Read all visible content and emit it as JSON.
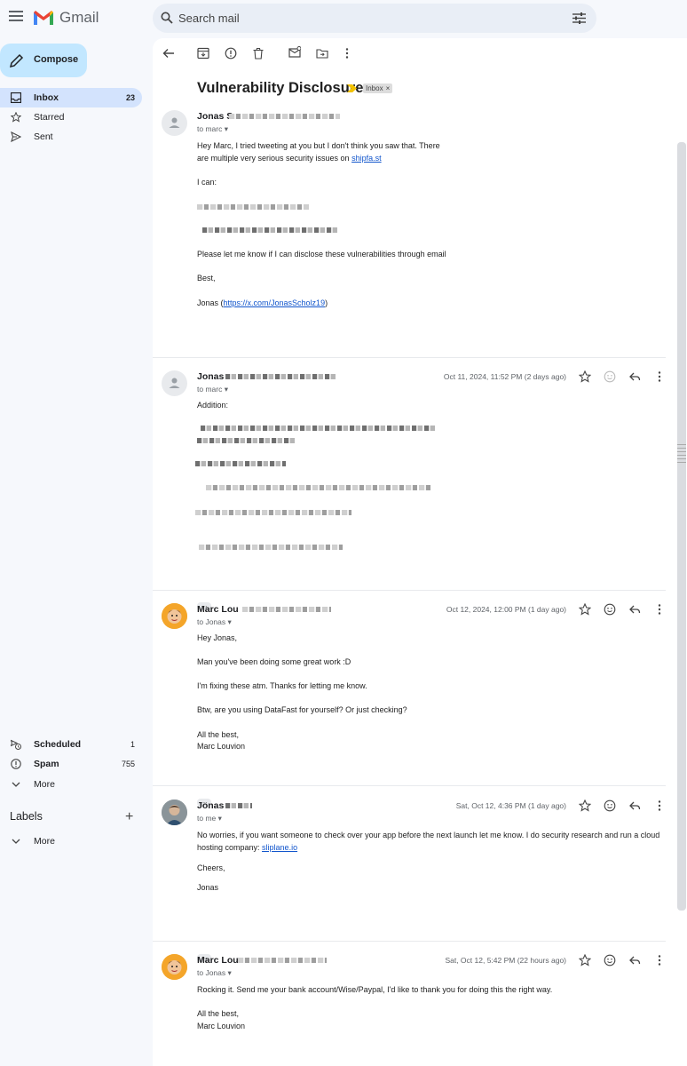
{
  "app": {
    "name": "Gmail"
  },
  "search": {
    "placeholder": "Search mail"
  },
  "sidebar": {
    "compose_label": "Compose",
    "items": [
      {
        "label": "Inbox",
        "count": "23",
        "icon": "inbox-icon",
        "active": true
      },
      {
        "label": "Starred",
        "count": "",
        "icon": "star-icon"
      },
      {
        "label": "Sent",
        "count": "",
        "icon": "send-icon"
      },
      {
        "label": "Scheduled",
        "count": "1",
        "icon": "scheduled-icon"
      },
      {
        "label": "Spam",
        "count": "755",
        "icon": "spam-icon"
      },
      {
        "label": "More",
        "count": "",
        "icon": "chevron-down-icon"
      }
    ],
    "labels_heading": "Labels",
    "labels_more": "More"
  },
  "thread": {
    "subject": "Vulnerability Disclosure",
    "chip": "Inbox",
    "chip_close": "×",
    "messages": [
      {
        "sender": "Jonas S",
        "to": "to marc",
        "date": "",
        "lines": [
          "Hey Marc, I tried tweeting at you but I don't think you saw that. There",
          "are multiple very serious security issues on ",
          "I can:",
          "Please let me know if I can disclose these vulnerabilities through email",
          "Best,",
          "Jonas (",
          ")"
        ],
        "link1": "shipfa.st",
        "link2": "https://x.com/JonasScholz19"
      },
      {
        "sender": "Jonas",
        "to": "to marc",
        "date": "Oct 11, 2024, 11:52 PM (2 days ago)",
        "lines": [
          "Addition:"
        ]
      },
      {
        "sender": "Marc Lou",
        "to": "to Jonas",
        "date": "Oct 12, 2024, 12:00 PM (1 day ago)",
        "lines": [
          "Hey Jonas,",
          "Man you've been doing some great work :D",
          "I'm fixing these atm. Thanks for letting me know.",
          "Btw, are you using DataFast for yourself? Or just checking?",
          "All the best,",
          "Marc Louvion"
        ]
      },
      {
        "sender": "Jonas",
        "to": "to me",
        "date": "Sat, Oct 12, 4:36 PM (1 day ago)",
        "lines": [
          "No worries, if you want someone to check over your app before the next launch let me know. I do security research and run a cloud",
          "hosting company: ",
          "Cheers,",
          "Jonas"
        ],
        "link1": "sliplane.io"
      },
      {
        "sender": "Marc Lou",
        "to": "to Jonas",
        "date": "Sat, Oct 12, 5:42 PM (22 hours ago)",
        "lines": [
          "Rocking it. Send me your bank account/Wise/Paypal, I'd like to thank you for doing this the right way.",
          "All the best,",
          "Marc Louvion"
        ]
      }
    ]
  },
  "colors": {
    "accent": "#c2e7ff",
    "active_nav": "#d3e3fd",
    "link": "#1155cc",
    "important": "#f2c200"
  }
}
